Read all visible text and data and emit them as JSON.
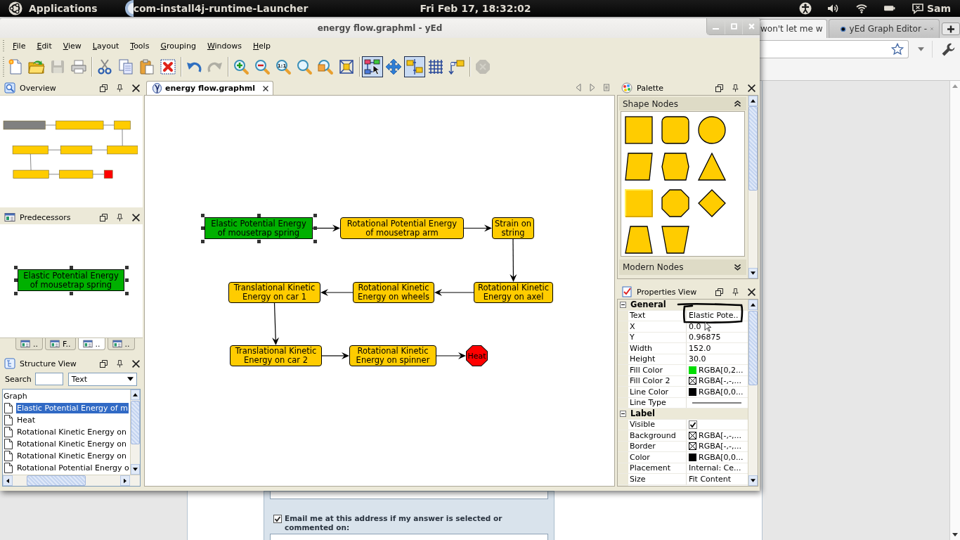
{
  "top_panel": {
    "menu": "Applications",
    "app_title": "com-install4j-runtime-Launcher",
    "clock": "Fri Feb 17, 18:32:02",
    "user": "Sam"
  },
  "browser": {
    "tabs": [
      {
        "title": "won't let me w",
        "selected": true
      },
      {
        "title": "yEd Graph Editor -",
        "selected": false
      }
    ],
    "answer_form": {
      "email_notify": {
        "label": "Email me at this address if my answer is selected or commented on:",
        "checked": true
      }
    }
  },
  "window": {
    "title": "energy flow.graphml - yEd"
  },
  "menu": [
    "File",
    "Edit",
    "View",
    "Layout",
    "Tools",
    "Grouping",
    "Windows",
    "Help"
  ],
  "toolbar": [
    {
      "buttons": [
        {
          "kind": "new",
          "disabled": false,
          "on": false
        },
        {
          "kind": "open",
          "disabled": false,
          "on": false
        },
        {
          "kind": "save",
          "disabled": true,
          "on": false
        },
        {
          "kind": "print",
          "disabled": false,
          "on": false
        }
      ]
    },
    {
      "buttons": [
        {
          "kind": "cut",
          "disabled": false,
          "on": false
        },
        {
          "kind": "copy",
          "disabled": false,
          "on": false
        },
        {
          "kind": "paste",
          "disabled": false,
          "on": false
        },
        {
          "kind": "delete",
          "disabled": false,
          "on": false
        }
      ]
    },
    {
      "buttons": [
        {
          "kind": "undo",
          "disabled": false,
          "on": false
        },
        {
          "kind": "redo",
          "disabled": true,
          "on": false
        }
      ]
    },
    {
      "buttons": [
        {
          "kind": "zoomin",
          "disabled": false,
          "on": false
        },
        {
          "kind": "zoomout",
          "disabled": false,
          "on": false
        },
        {
          "kind": "zoomactual",
          "label": "1:1",
          "disabled": false,
          "on": false
        },
        {
          "kind": "zoom",
          "disabled": false,
          "on": false
        },
        {
          "kind": "zoomsel",
          "disabled": false,
          "on": false
        },
        {
          "kind": "fit",
          "disabled": false,
          "on": false
        }
      ]
    },
    {
      "buttons": [
        {
          "kind": "edit",
          "disabled": false,
          "on": true
        },
        {
          "kind": "navigate",
          "disabled": false,
          "on": false
        },
        {
          "kind": "snap",
          "disabled": false,
          "on": true
        },
        {
          "kind": "grid",
          "disabled": false,
          "on": false
        },
        {
          "kind": "port",
          "disabled": false,
          "on": false
        }
      ]
    },
    {
      "buttons": [
        {
          "kind": "extra",
          "disabled": true,
          "on": false
        }
      ]
    }
  ],
  "overview": {
    "title": "Overview"
  },
  "predecessors": {
    "title": "Predecessors",
    "node": {
      "lines": [
        "Elastic Potential Energy",
        "of mousetrap spring"
      ],
      "color": "#00b000",
      "selected": true
    }
  },
  "dock_tabs": [
    {
      "label": "..",
      "selected": false
    },
    {
      "label": "F..",
      "selected": false
    },
    {
      "label": "..",
      "selected": true
    },
    {
      "label": "..",
      "selected": false
    }
  ],
  "structure_view": {
    "title": "Structure View",
    "search_label": "Search",
    "filter": "Text",
    "tree": [
      {
        "label": "Graph",
        "selected": false,
        "children": [
          {
            "label": "Elastic Potential Energy of m",
            "selected": true
          },
          {
            "label": "Heat",
            "selected": false
          },
          {
            "label": "Rotational Kinetic Energy on",
            "selected": false
          },
          {
            "label": "Rotational Kinetic Energy on",
            "selected": false
          },
          {
            "label": "Rotational Kinetic Energy on",
            "selected": false
          },
          {
            "label": "Rotational Potential Energy o",
            "selected": false
          }
        ]
      }
    ]
  },
  "document_tab": {
    "title": "energy flow.graphml"
  },
  "graph": {
    "nodes": [
      {
        "lines": [
          "Elastic Potential Energy",
          "of mousetrap spring"
        ],
        "kind": "rectangle",
        "color": "#00b000",
        "selected": true,
        "edge": {
          "kind": "right"
        }
      },
      {
        "lines": [
          "Rotational Potential Energy",
          "of mousetrap arm"
        ],
        "kind": "roundrect",
        "color": "#ffcc00",
        "selected": false,
        "edge": {
          "kind": "right"
        }
      },
      {
        "lines": [
          "Strain on",
          "string"
        ],
        "kind": "roundrect",
        "color": "#ffcc00",
        "selected": false,
        "edge": {
          "kind": "down"
        }
      },
      {
        "lines": [
          "Translational Kinetic",
          "Energy on car 1"
        ],
        "kind": "roundrect",
        "color": "#ffcc00",
        "selected": false,
        "edge": {
          "kind": "down"
        }
      },
      {
        "lines": [
          "Rotational Kinetic",
          "Energy on wheels"
        ],
        "kind": "roundrect",
        "color": "#ffcc00",
        "selected": false,
        "edge": {
          "kind": "left"
        }
      },
      {
        "lines": [
          "Rotational Kinetic",
          "Energy on axel"
        ],
        "kind": "roundrect",
        "color": "#ffcc00",
        "selected": false,
        "edge": {
          "kind": "left"
        }
      },
      {
        "lines": [
          "Translational Kinetic",
          "Energy on car 2"
        ],
        "kind": "roundrect",
        "color": "#ffcc00",
        "selected": false,
        "edge": {
          "kind": "right"
        }
      },
      {
        "lines": [
          "Rotational Kinetic",
          "Energy on spinner"
        ],
        "kind": "roundrect",
        "color": "#ffcc00",
        "selected": false,
        "edge": {
          "kind": "right"
        }
      },
      {
        "lines": [
          "Heat"
        ],
        "kind": "octagon",
        "color": "#ff0000",
        "selected": false
      }
    ]
  },
  "palette": {
    "title": "Palette",
    "sections": [
      {
        "title": "Shape Nodes",
        "expanded": true
      },
      {
        "title": "Modern Nodes",
        "expanded": false
      }
    ]
  },
  "properties": {
    "title": "Properties View",
    "sections": [
      {
        "title": "General",
        "expanded": true,
        "rows": [
          {
            "label": "Text",
            "kind": "text",
            "value": "Elastic Pote.."
          },
          {
            "label": "X",
            "kind": "text",
            "value": "0.0"
          },
          {
            "label": "Y",
            "kind": "text",
            "value": "0.96875"
          },
          {
            "label": "Width",
            "kind": "text",
            "value": "152.0"
          },
          {
            "label": "Height",
            "kind": "text",
            "value": "30.0"
          },
          {
            "label": "Fill Color",
            "kind": "color",
            "color": "#00dd00",
            "value": "RGBA[0,2..."
          },
          {
            "label": "Fill Color 2",
            "kind": "nocolor",
            "value": "RGBA[-,-,..."
          },
          {
            "label": "Line Color",
            "kind": "color",
            "color": "#000000",
            "value": "RGBA[0,0..."
          },
          {
            "label": "Line Type",
            "kind": "line"
          }
        ]
      },
      {
        "title": "Label",
        "expanded": true,
        "rows": [
          {
            "label": "Visible",
            "kind": "check",
            "checked": true
          },
          {
            "label": "Background",
            "kind": "nocolor",
            "value": "RGBA[-,-,..."
          },
          {
            "label": "Border",
            "kind": "nocolor",
            "value": "RGBA[-,-,..."
          },
          {
            "label": "Color",
            "kind": "color",
            "color": "#000000",
            "value": "RGBA[0,0..."
          },
          {
            "label": "Placement",
            "kind": "text",
            "value": "Internal: Ce..."
          },
          {
            "label": "Size",
            "kind": "text",
            "value": "Fit Content"
          }
        ]
      }
    ]
  }
}
